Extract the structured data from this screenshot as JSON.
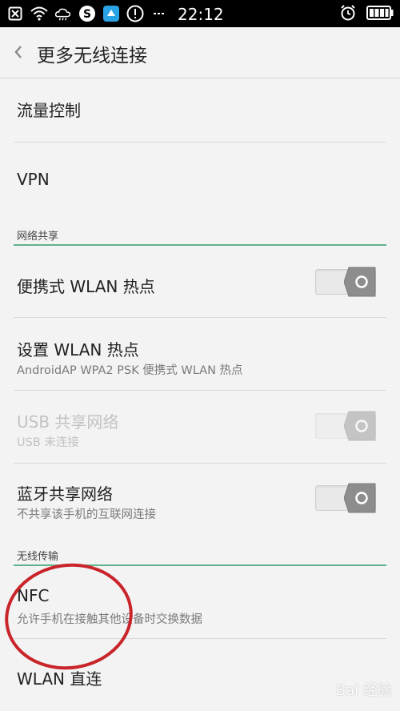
{
  "status_bar": {
    "time": "22:12",
    "icons_left": [
      "close-box-icon",
      "wifi-icon",
      "cloud-icon",
      "skype-icon",
      "app-icon",
      "alert-icon",
      "more-icon"
    ],
    "icons_right": [
      "alarm-icon",
      "battery-icon"
    ]
  },
  "header": {
    "title": "更多无线连接"
  },
  "items": {
    "traffic": {
      "label": "流量控制"
    },
    "vpn": {
      "label": "VPN"
    },
    "section_share": "网络共享",
    "hotspot": {
      "label": "便携式 WLAN 热点",
      "toggle": "off"
    },
    "hotspot_settings": {
      "label": "设置 WLAN 热点",
      "sub": "AndroidAP WPA2 PSK 便携式 WLAN 热点"
    },
    "usb": {
      "label": "USB 共享网络",
      "sub": "USB 未连接",
      "toggle": "off"
    },
    "bt": {
      "label": "蓝牙共享网络",
      "sub": "不共享该手机的互联网连接",
      "toggle": "off"
    },
    "section_wireless": "无线传输",
    "nfc": {
      "label": "NFC",
      "sub": "允许手机在接触其他设备时交换数据"
    },
    "wlan_direct": {
      "label": "WLAN 直连"
    }
  },
  "colors": {
    "accent": "#5fb38b",
    "annotation": "#c9242a"
  },
  "watermark": "Bai 经验"
}
